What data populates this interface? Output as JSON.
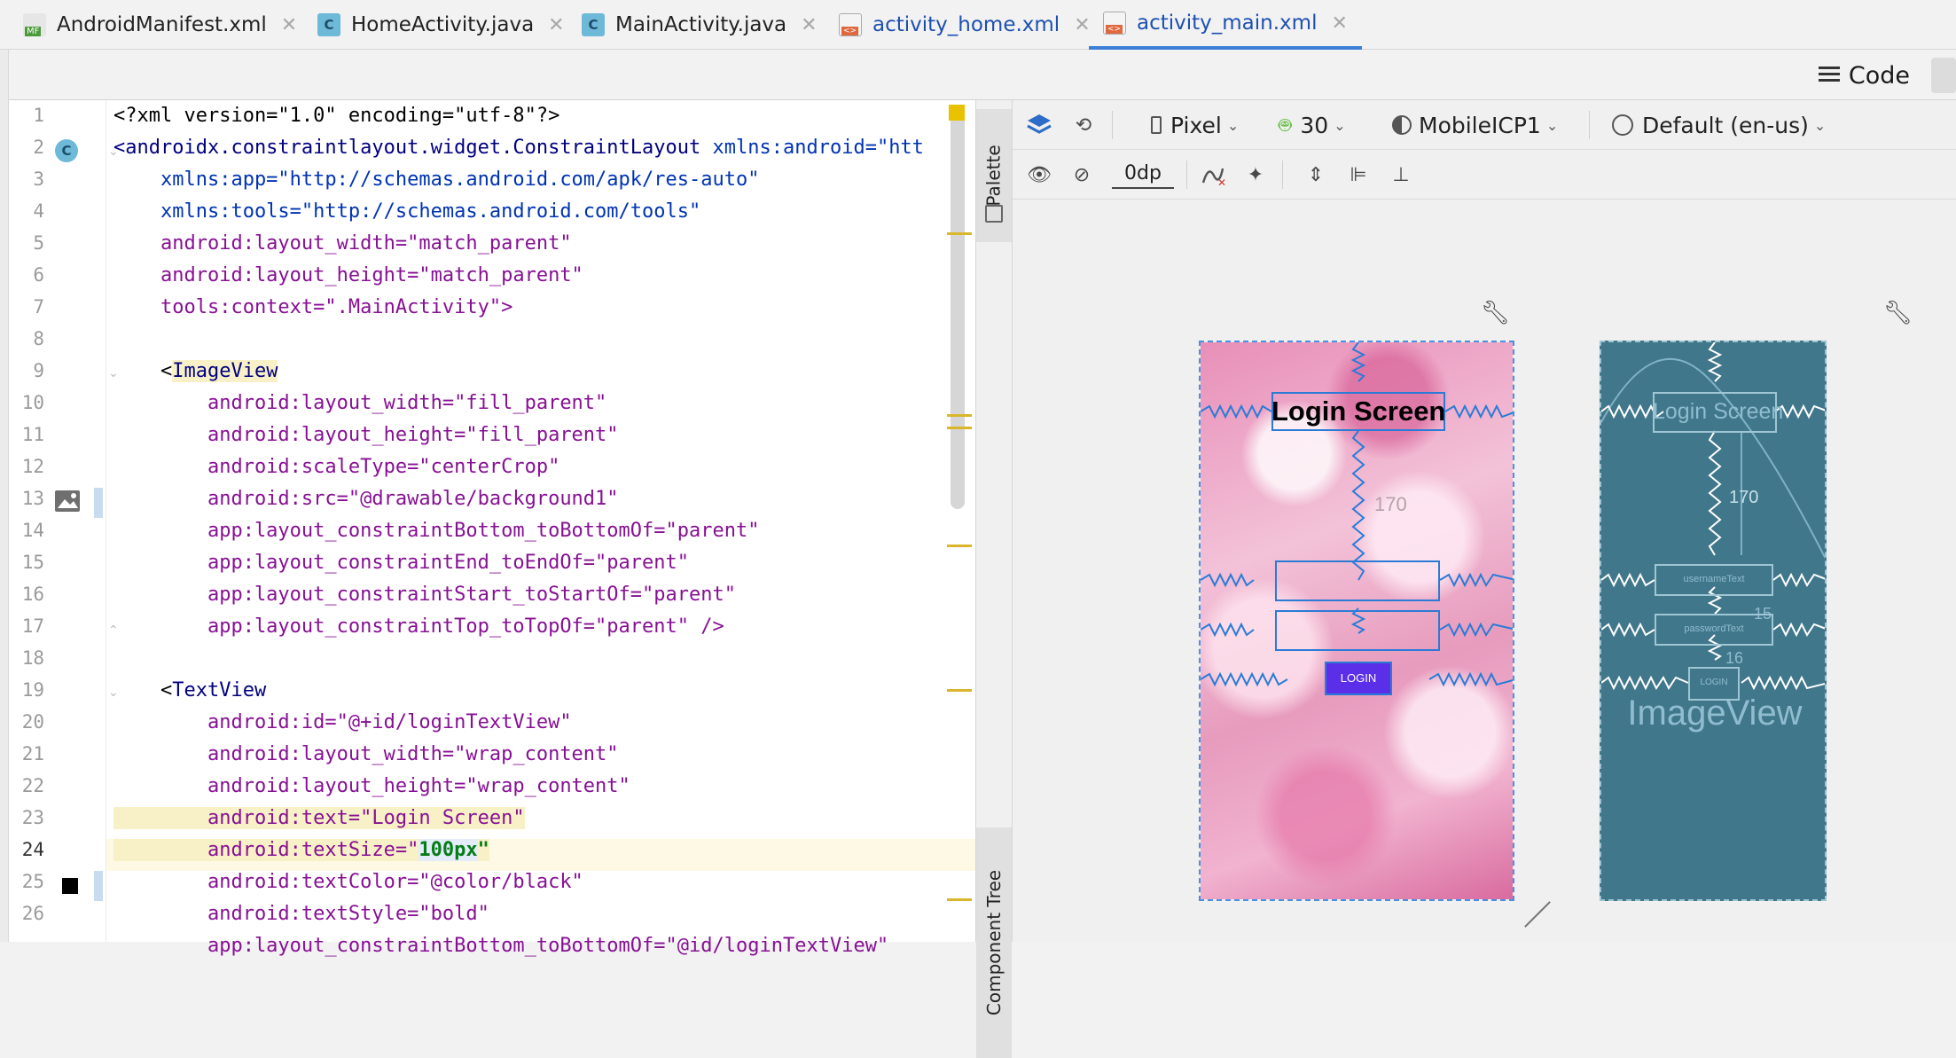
{
  "tabs": [
    {
      "label": "AndroidManifest.xml",
      "icon": "manifest-file-icon",
      "active": false
    },
    {
      "label": "HomeActivity.java",
      "icon": "java-class-icon",
      "active": false
    },
    {
      "label": "MainActivity.java",
      "icon": "java-class-icon",
      "active": false
    },
    {
      "label": "activity_home.xml",
      "icon": "layout-xml-icon",
      "active": false
    },
    {
      "label": "activity_main.xml",
      "icon": "layout-xml-icon",
      "active": true
    }
  ],
  "view_mode": {
    "label": "Code",
    "icon": "code-view-icon"
  },
  "editor": {
    "line_numbers": [
      "1",
      "2",
      "3",
      "4",
      "5",
      "6",
      "7",
      "8",
      "9",
      "10",
      "11",
      "12",
      "13",
      "14",
      "15",
      "16",
      "17",
      "18",
      "19",
      "20",
      "21",
      "22",
      "23",
      "24",
      "25",
      "26"
    ],
    "current_line": "24",
    "lines": {
      "l1": "<?xml version=\"1.0\" encoding=\"utf-8\"?>",
      "l2a": "<androidx.constraintlayout.widget.ConstraintLayout",
      "l2b": " xmlns:android=\"htt",
      "l3": "    xmlns:app=\"http://schemas.android.com/apk/res-auto\"",
      "l4": "    xmlns:tools=\"http://schemas.android.com/tools\"",
      "l5": "    android:layout_width=\"match_parent\"",
      "l6": "    android:layout_height=\"match_parent\"",
      "l7": "    tools:context=\".MainActivity\">",
      "l9a": "    <",
      "l9b": "ImageView",
      "l10": "        android:layout_width=\"fill_parent\"",
      "l11": "        android:layout_height=\"fill_parent\"",
      "l12": "        android:scaleType=\"centerCrop\"",
      "l13": "        android:src=\"@drawable/background1\"",
      "l14": "        app:layout_constraintBottom_toBottomOf=\"parent\"",
      "l15": "        app:layout_constraintEnd_toEndOf=\"parent\"",
      "l16": "        app:layout_constraintStart_toStartOf=\"parent\"",
      "l17": "        app:layout_constraintTop_toTopOf=\"parent\" />",
      "l19a": "    <",
      "l19b": "TextView",
      "l20": "        android:id=\"@+id/loginTextView\"",
      "l21": "        android:layout_width=\"wrap_content\"",
      "l22": "        android:layout_height=\"wrap_content\"",
      "l23": "        android:text=\"Login Screen\"",
      "l24a": "        android:textSize=\"",
      "l24b": "100px",
      "l24c": "\"",
      "l25": "        android:textColor=\"@color/black\"",
      "l26": "        android:textStyle=\"bold\"",
      "l27": "        app:layout_constraintBottom_toBottomOf=\"@id/loginTextView\""
    }
  },
  "side_tabs": {
    "palette": "Palette",
    "component_tree": "Component Tree"
  },
  "design_toolbar": {
    "device": "Pixel",
    "api_level": "30",
    "theme": "MobileICP1",
    "locale": "Default (en-us)",
    "default_margin": "0dp"
  },
  "design_preview": {
    "title": "Login Screen",
    "margin_label": "170",
    "login_button": "LOGIN"
  },
  "blueprint": {
    "title": "Login Screen",
    "margin_label": "170",
    "username_field": "usernameText",
    "password_field": "passwordText",
    "login_button": "LOGIN",
    "margin_15": "15",
    "margin_16": "16",
    "image_label": "ImageView"
  },
  "colors": {
    "accent": "#3d7fd6",
    "blueprint_bg": "#41778b",
    "button_purple": "#5b2ee8",
    "constraint_blue": "#2b7bd6"
  }
}
